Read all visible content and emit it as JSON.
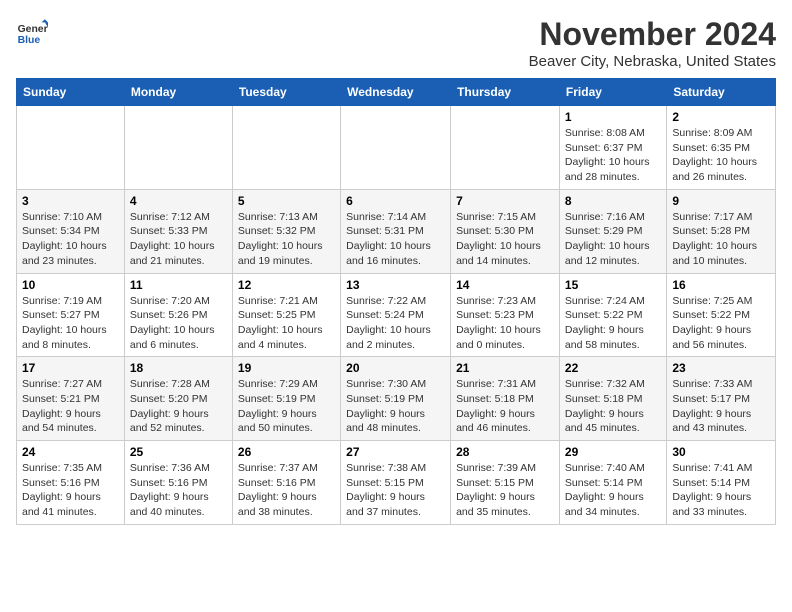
{
  "logo": {
    "line1": "General",
    "line2": "Blue"
  },
  "title": "November 2024",
  "location": "Beaver City, Nebraska, United States",
  "weekdays": [
    "Sunday",
    "Monday",
    "Tuesday",
    "Wednesday",
    "Thursday",
    "Friday",
    "Saturday"
  ],
  "weeks": [
    [
      {
        "day": "",
        "info": ""
      },
      {
        "day": "",
        "info": ""
      },
      {
        "day": "",
        "info": ""
      },
      {
        "day": "",
        "info": ""
      },
      {
        "day": "",
        "info": ""
      },
      {
        "day": "1",
        "info": "Sunrise: 8:08 AM\nSunset: 6:37 PM\nDaylight: 10 hours\nand 28 minutes."
      },
      {
        "day": "2",
        "info": "Sunrise: 8:09 AM\nSunset: 6:35 PM\nDaylight: 10 hours\nand 26 minutes."
      }
    ],
    [
      {
        "day": "3",
        "info": "Sunrise: 7:10 AM\nSunset: 5:34 PM\nDaylight: 10 hours\nand 23 minutes."
      },
      {
        "day": "4",
        "info": "Sunrise: 7:12 AM\nSunset: 5:33 PM\nDaylight: 10 hours\nand 21 minutes."
      },
      {
        "day": "5",
        "info": "Sunrise: 7:13 AM\nSunset: 5:32 PM\nDaylight: 10 hours\nand 19 minutes."
      },
      {
        "day": "6",
        "info": "Sunrise: 7:14 AM\nSunset: 5:31 PM\nDaylight: 10 hours\nand 16 minutes."
      },
      {
        "day": "7",
        "info": "Sunrise: 7:15 AM\nSunset: 5:30 PM\nDaylight: 10 hours\nand 14 minutes."
      },
      {
        "day": "8",
        "info": "Sunrise: 7:16 AM\nSunset: 5:29 PM\nDaylight: 10 hours\nand 12 minutes."
      },
      {
        "day": "9",
        "info": "Sunrise: 7:17 AM\nSunset: 5:28 PM\nDaylight: 10 hours\nand 10 minutes."
      }
    ],
    [
      {
        "day": "10",
        "info": "Sunrise: 7:19 AM\nSunset: 5:27 PM\nDaylight: 10 hours\nand 8 minutes."
      },
      {
        "day": "11",
        "info": "Sunrise: 7:20 AM\nSunset: 5:26 PM\nDaylight: 10 hours\nand 6 minutes."
      },
      {
        "day": "12",
        "info": "Sunrise: 7:21 AM\nSunset: 5:25 PM\nDaylight: 10 hours\nand 4 minutes."
      },
      {
        "day": "13",
        "info": "Sunrise: 7:22 AM\nSunset: 5:24 PM\nDaylight: 10 hours\nand 2 minutes."
      },
      {
        "day": "14",
        "info": "Sunrise: 7:23 AM\nSunset: 5:23 PM\nDaylight: 10 hours\nand 0 minutes."
      },
      {
        "day": "15",
        "info": "Sunrise: 7:24 AM\nSunset: 5:22 PM\nDaylight: 9 hours\nand 58 minutes."
      },
      {
        "day": "16",
        "info": "Sunrise: 7:25 AM\nSunset: 5:22 PM\nDaylight: 9 hours\nand 56 minutes."
      }
    ],
    [
      {
        "day": "17",
        "info": "Sunrise: 7:27 AM\nSunset: 5:21 PM\nDaylight: 9 hours\nand 54 minutes."
      },
      {
        "day": "18",
        "info": "Sunrise: 7:28 AM\nSunset: 5:20 PM\nDaylight: 9 hours\nand 52 minutes."
      },
      {
        "day": "19",
        "info": "Sunrise: 7:29 AM\nSunset: 5:19 PM\nDaylight: 9 hours\nand 50 minutes."
      },
      {
        "day": "20",
        "info": "Sunrise: 7:30 AM\nSunset: 5:19 PM\nDaylight: 9 hours\nand 48 minutes."
      },
      {
        "day": "21",
        "info": "Sunrise: 7:31 AM\nSunset: 5:18 PM\nDaylight: 9 hours\nand 46 minutes."
      },
      {
        "day": "22",
        "info": "Sunrise: 7:32 AM\nSunset: 5:18 PM\nDaylight: 9 hours\nand 45 minutes."
      },
      {
        "day": "23",
        "info": "Sunrise: 7:33 AM\nSunset: 5:17 PM\nDaylight: 9 hours\nand 43 minutes."
      }
    ],
    [
      {
        "day": "24",
        "info": "Sunrise: 7:35 AM\nSunset: 5:16 PM\nDaylight: 9 hours\nand 41 minutes."
      },
      {
        "day": "25",
        "info": "Sunrise: 7:36 AM\nSunset: 5:16 PM\nDaylight: 9 hours\nand 40 minutes."
      },
      {
        "day": "26",
        "info": "Sunrise: 7:37 AM\nSunset: 5:16 PM\nDaylight: 9 hours\nand 38 minutes."
      },
      {
        "day": "27",
        "info": "Sunrise: 7:38 AM\nSunset: 5:15 PM\nDaylight: 9 hours\nand 37 minutes."
      },
      {
        "day": "28",
        "info": "Sunrise: 7:39 AM\nSunset: 5:15 PM\nDaylight: 9 hours\nand 35 minutes."
      },
      {
        "day": "29",
        "info": "Sunrise: 7:40 AM\nSunset: 5:14 PM\nDaylight: 9 hours\nand 34 minutes."
      },
      {
        "day": "30",
        "info": "Sunrise: 7:41 AM\nSunset: 5:14 PM\nDaylight: 9 hours\nand 33 minutes."
      }
    ]
  ]
}
